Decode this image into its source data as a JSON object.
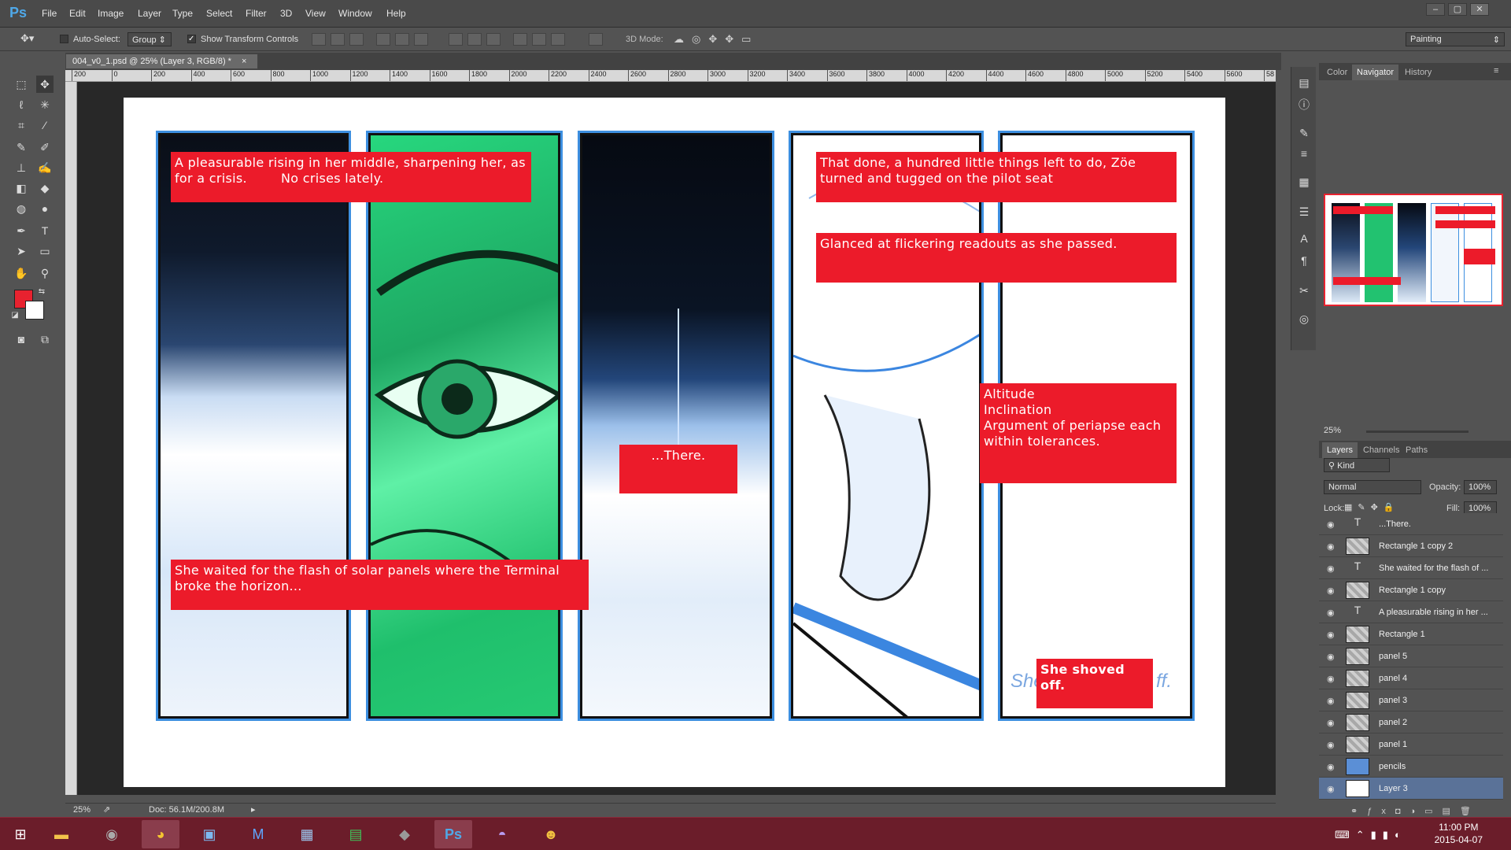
{
  "app": {
    "logo": "Ps",
    "menu": [
      "File",
      "Edit",
      "Image",
      "Layer",
      "Type",
      "Select",
      "Filter",
      "3D",
      "View",
      "Window",
      "Help"
    ]
  },
  "options": {
    "auto_select_label": "Auto-Select:",
    "auto_select_value": "Group",
    "show_transform_label": "Show Transform Controls",
    "mode3d_label": "3D Mode:",
    "workspace": "Painting"
  },
  "document": {
    "tab_title": "004_v0_1.psd @ 25% (Layer 3, RGB/8) *",
    "ruler_ticks": [
      "200",
      "0",
      "200",
      "400",
      "600",
      "800",
      "1000",
      "1200",
      "1400",
      "1600",
      "1800",
      "2000",
      "2200",
      "2400",
      "2600",
      "2800",
      "3000",
      "3200",
      "3400",
      "3600",
      "3800",
      "4000",
      "4200",
      "4400",
      "4600",
      "4800",
      "5000",
      "5200",
      "5400",
      "5600",
      "58"
    ],
    "zoom": "25%",
    "doc_size": "Doc: 56.1M/200.8M"
  },
  "captions": {
    "c1": "A pleasurable rising in her middle, sharpening her, as for a crisis.        No crises lately.",
    "c2": "She waited for the flash of solar panels where the Terminal broke the horizon...",
    "c3": "...There.",
    "c4": "That done, a hundred little things left to do, Zöe turned and tugged on the pilot seat",
    "c5": "Glanced at flickering readouts as she passed.",
    "c6": "Altitude\nInclination\nArgument of periapse each within tolerances.",
    "c7": "She shoved off.",
    "pencil_left": "She",
    "pencil_right": "ff."
  },
  "right_panels": {
    "top_tabs": [
      "Color",
      "Navigator",
      "History"
    ],
    "nav_zoom": "25%",
    "layer_tabs": [
      "Layers",
      "Channels",
      "Paths"
    ],
    "kind": "Kind",
    "blend_mode": "Normal",
    "opacity_label": "Opacity:",
    "opacity": "100%",
    "lock_label": "Lock:",
    "fill_label": "Fill:",
    "fill": "100%",
    "layers": [
      {
        "name": "...There.",
        "type": "text"
      },
      {
        "name": "Rectangle 1 copy 2",
        "type": "shape"
      },
      {
        "name": "She waited for the flash of ...",
        "type": "text"
      },
      {
        "name": "Rectangle 1 copy",
        "type": "shape"
      },
      {
        "name": "A pleasurable rising in her ...",
        "type": "text"
      },
      {
        "name": "Rectangle 1",
        "type": "shape"
      },
      {
        "name": "panel 5",
        "type": "image"
      },
      {
        "name": "panel 4",
        "type": "image"
      },
      {
        "name": "panel 3",
        "type": "image"
      },
      {
        "name": "panel 2",
        "type": "image"
      },
      {
        "name": "panel 1",
        "type": "image"
      },
      {
        "name": "pencils",
        "type": "image"
      },
      {
        "name": "Layer 3",
        "type": "image",
        "selected": true
      }
    ]
  },
  "taskbar": {
    "time": "11:00 PM",
    "date": "2015-04-07"
  },
  "colors": {
    "caption_red": "#ec1b2a",
    "foreground": "#e8222f",
    "background": "#ffffff",
    "taskbar": "#6b1d2a",
    "selected_layer": "#5a7298"
  }
}
